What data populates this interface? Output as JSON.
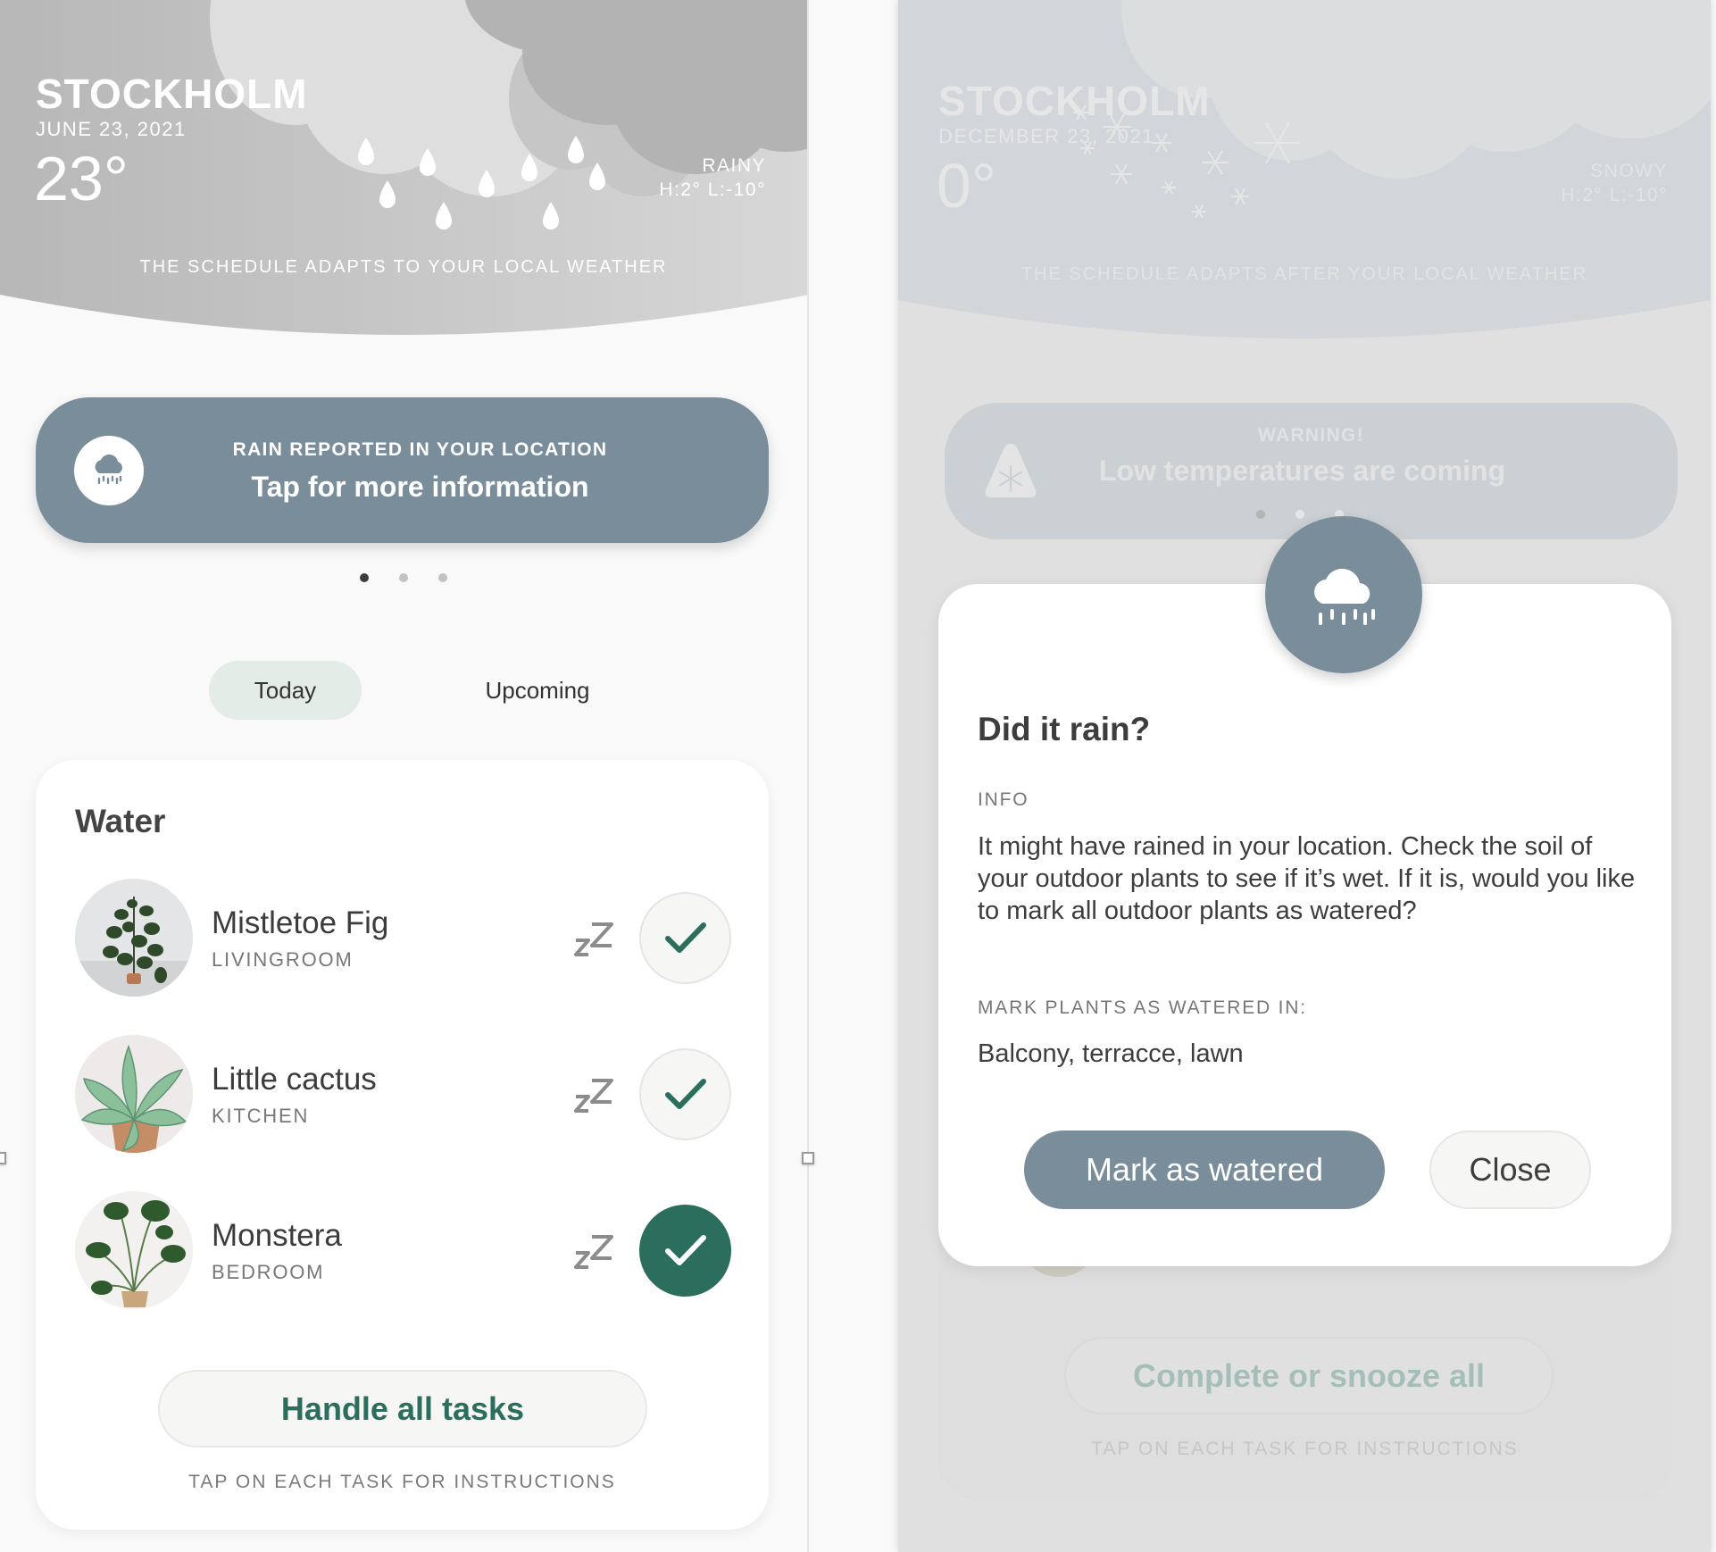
{
  "left_screen": {
    "header": {
      "city": "STOCKHOLM",
      "date": "JUNE 23, 2021",
      "temperature": "23°",
      "condition": "RAINY",
      "high_low": "H:2° L:-10°",
      "tagline": "THE SCHEDULE ADAPTS TO YOUR LOCAL WEATHER",
      "weather_icon": "rain-cloud"
    },
    "alert_banner": {
      "icon": "rain-cloud-icon",
      "subtitle": "RAIN REPORTED IN YOUR LOCATION",
      "title": "Tap for more information",
      "pages_total": 3,
      "page_active": 1
    },
    "tabs": [
      {
        "label": "Today",
        "active": true
      },
      {
        "label": "Upcoming",
        "active": false
      }
    ],
    "task_card": {
      "title": "Water",
      "tasks": [
        {
          "name": "Mistletoe Fig",
          "room": "LIVINGROOM",
          "done": false,
          "snooze_icon": "zz-icon",
          "check_icon": "check-icon"
        },
        {
          "name": "Little cactus",
          "room": "KITCHEN",
          "done": false,
          "snooze_icon": "zz-icon",
          "check_icon": "check-icon"
        },
        {
          "name": "Monstera",
          "room": "BEDROOM",
          "done": true,
          "snooze_icon": "zz-icon",
          "check_icon": "check-icon"
        }
      ],
      "handle_all_label": "Handle all tasks",
      "hint": "TAP ON EACH TASK FOR INSTRUCTIONS"
    }
  },
  "right_screen": {
    "header": {
      "city": "STOCKHOLM",
      "date": "DECEMBER 23, 2021",
      "temperature": "0°",
      "condition": "SNOWY",
      "high_low": "H:2° L:-10°",
      "tagline": "THE SCHEDULE ADAPTS AFTER YOUR LOCAL WEATHER",
      "weather_icon": "snow-cloud"
    },
    "alert_banner": {
      "icon": "snowflake-warning-icon",
      "subtitle": "WARNING!",
      "title": "Low temperatures are coming",
      "pages_total": 3,
      "page_active": 1
    },
    "background_card": {
      "complete_all_label": "Complete or snooze all",
      "hint": "TAP ON EACH TASK FOR INSTRUCTIONS"
    },
    "modal": {
      "icon": "rain-cloud-icon",
      "title": "Did it rain?",
      "info_label": "INFO",
      "info_text": "It might have rained in your location. Check the soil of your outdoor plants to see if it’s wet. If it is, would you like to mark all outdoor plants as watered?",
      "locations_label": "MARK PLANTS AS WATERED IN:",
      "locations_value": "Balcony, terracce, lawn",
      "primary_button": "Mark as watered",
      "secondary_button": "Close"
    }
  },
  "colors": {
    "accent_slate": "#798d9b",
    "accent_green": "#2c6e5d",
    "tab_active_bg": "#e4ece8",
    "text_dark": "#3d3d3d"
  }
}
